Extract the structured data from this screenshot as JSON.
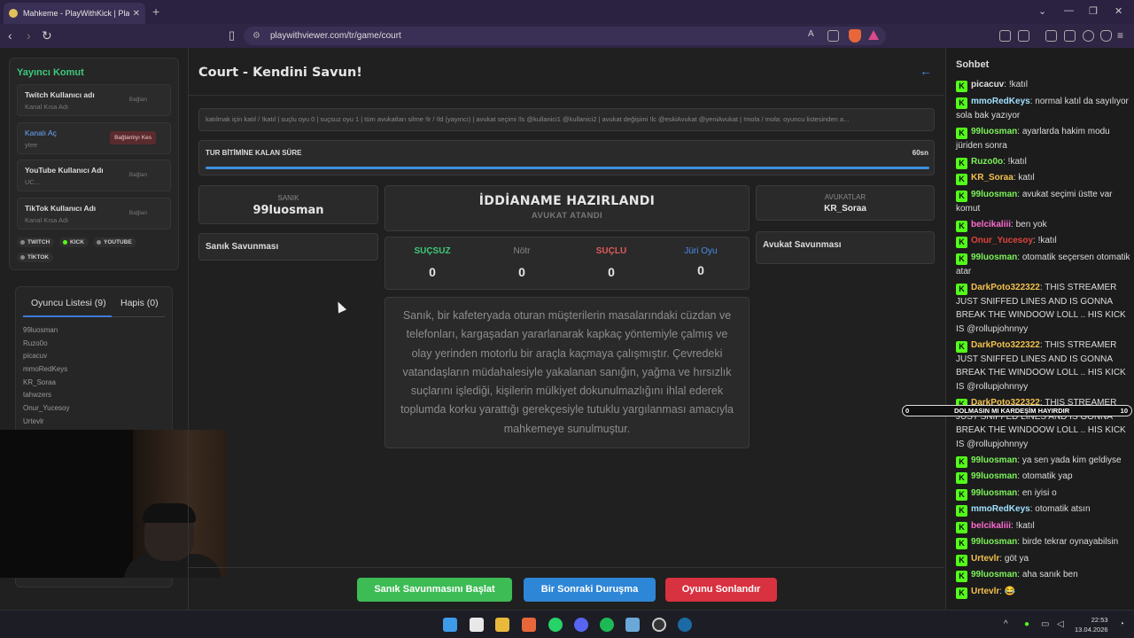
{
  "browser": {
    "tab_title": "Mahkeme - PlayWithKick | PlayW",
    "url": "playwithviewer.com/tr/game/court"
  },
  "sidebar": {
    "title": "Yayıncı Komut",
    "accounts": [
      {
        "name": "Twitch Kullanıcı adı",
        "sub": "Kanal Kısa Adı",
        "action": "Bağlan"
      },
      {
        "name": "Kanalı Aç",
        "sub": "ytee",
        "action": "Bağlantıyı Kes"
      },
      {
        "name": "YouTube Kullanıcı Adı",
        "sub": "UC...",
        "action": "Bağlan"
      },
      {
        "name": "TikTok Kullanıcı Adı",
        "sub": "Kanal Kısa Adı",
        "action": "Bağlan"
      }
    ],
    "platforms": [
      "TWITCH",
      "KICK",
      "YOUTUBE",
      "TİKTOK"
    ],
    "platform_colors": [
      "#888888",
      "#53fc18",
      "#888888",
      "#888888"
    ]
  },
  "players": {
    "tab_players": "Oyuncu Listesi (9)",
    "tab_jail": "Hapis (0)",
    "list": [
      "99luosman",
      "Ruzo0o",
      "picacuv",
      "mmoRedKeys",
      "KR_Soraa",
      "tahwzers",
      "Onur_Yucesoy",
      "Urtevlr",
      "belcikalii"
    ]
  },
  "main": {
    "title": "Court - Kendini Savun!",
    "commands": "katılmak için katıl / !katıl | suçlu oyu 0 | suçsuz oyu 1 | tüm avukatları silme !lr / !ld (yayıncı) | avukat seçimi !ls @kullanici1 @kullanici2 | avukat değişimi !lc @eskiAvukat @yeniAvukat | !mola / mola: oyuncu listesinden a...",
    "timer_label": "TUR BİTİMİNE KALAN SÜRE",
    "timer_value": "60sn",
    "timer_fraction": 1.0,
    "defendant_label": "SANIK",
    "defendant_name": "99luosman",
    "defendant_defense": "Sanık Savunması",
    "indictment_title": "İDDİANAME HAZIRLANDI",
    "indictment_sub": "AVUKAT ATANDI",
    "votes": [
      {
        "label": "SUÇSUZ",
        "value": "0",
        "color": "#3ec97a"
      },
      {
        "label": "Nötr",
        "value": "0",
        "color": "#888888"
      },
      {
        "label": "SUÇLU",
        "value": "0",
        "color": "#e05a5a"
      },
      {
        "label": "Jüri Oyu",
        "value": "0",
        "color": "#4a8cf0"
      }
    ],
    "story": "Sanık, bir kafeteryada oturan müşterilerin masalarındaki cüzdan ve telefonları, kargaşadan yararlanarak kapkaç yöntemiyle çalmış ve olay yerinden motorlu bir araçla kaçmaya çalışmıştır. Çevredeki vatandaşların müdahalesiyle yakalanan sanığın, yağma ve hırsızlık suçlarını işlediği, kişilerin mülkiyet dokunulmazlığını ihlal ederek toplumda korku yarattığı gerekçesiyle tutuklu yargılanması amacıyla mahkemeye sunulmuştur.",
    "lawyers_label": "AVUKATLAR",
    "lawyer_name": "KR_Soraa",
    "lawyer_defense": "Avukat Savunması",
    "buttons": [
      {
        "label": "Sanık Savunmasını Başlat",
        "color": "#3dbb55"
      },
      {
        "label": "Bir Sonraki Duruşma",
        "color": "#2e86d6"
      },
      {
        "label": "Oyunu Sonlandır",
        "color": "#d8313f"
      }
    ]
  },
  "chat": {
    "title": "Sohbet",
    "messages": [
      {
        "user": "picacuv",
        "color": "#e0e0e0",
        "text": "!katıl"
      },
      {
        "user": "mmoRedKeys",
        "color": "#9fe0ff",
        "text": "normal katıl da sayılıyor sola bak yazıyor"
      },
      {
        "user": "99luosman",
        "color": "#7cf25a",
        "text": "ayarlarda hakim modu jüriden sonra"
      },
      {
        "user": "Ruzo0o",
        "color": "#7cf25a",
        "text": "!katıl"
      },
      {
        "user": "KR_Soraa",
        "color": "#f2c14e",
        "text": "katıl"
      },
      {
        "user": "99luosman",
        "color": "#7cf25a",
        "text": "avukat seçimi üstte var komut"
      },
      {
        "user": "belcikaliii",
        "color": "#ff6bd1",
        "text": "ben yok"
      },
      {
        "user": "Onur_Yucesoy",
        "color": "#e0433f",
        "text": "!katıl"
      },
      {
        "user": "99luosman",
        "color": "#7cf25a",
        "text": "otomatik seçersen otomatik atar"
      },
      {
        "user": "DarkPoto322322",
        "color": "#f2c14e",
        "text": "THIS STREAMER JUST SNIFFED LINES AND IS GONNA BREAK THE WINDOOW LOLL .. HIS KICK IS @rollupjohnnyy"
      },
      {
        "user": "DarkPoto322322",
        "color": "#f2c14e",
        "text": "THIS STREAMER JUST SNIFFED LINES AND IS GONNA BREAK THE WINDOOW LOLL .. HIS KICK IS @rollupjohnnyy"
      },
      {
        "user": "DarkPoto322322",
        "color": "#f2c14e",
        "text": "THIS STREAMER JUST SNIFFED LINES AND IS GONNA BREAK THE WINDOOW LOLL .. HIS KICK IS @rollupjohnnyy"
      },
      {
        "user": "99luosman",
        "color": "#7cf25a",
        "text": "ya sen yada kim geldiyse"
      },
      {
        "user": "99luosman",
        "color": "#7cf25a",
        "text": "otomatik yap"
      },
      {
        "user": "99luosman",
        "color": "#7cf25a",
        "text": "en iyisi o"
      },
      {
        "user": "mmoRedKeys",
        "color": "#9fe0ff",
        "text": "otomatik atsın"
      },
      {
        "user": "belcikaliii",
        "color": "#ff6bd1",
        "text": "!katıl"
      },
      {
        "user": "99luosman",
        "color": "#7cf25a",
        "text": "birde tekrar oynayabilsin"
      },
      {
        "user": "Urtevlr",
        "color": "#f2c14e",
        "text": "göt ya"
      },
      {
        "user": "99luosman",
        "color": "#7cf25a",
        "text": "aha sanık ben"
      },
      {
        "user": "Urtevlr",
        "color": "#f2c14e",
        "text": "😂"
      }
    ],
    "poll": {
      "left": "0",
      "question": "DOLMASIN MI KARDEŞİM HAYIRDIR",
      "right": "10"
    }
  },
  "taskbar": {
    "time": "22:53",
    "date": "13.04.2026"
  }
}
